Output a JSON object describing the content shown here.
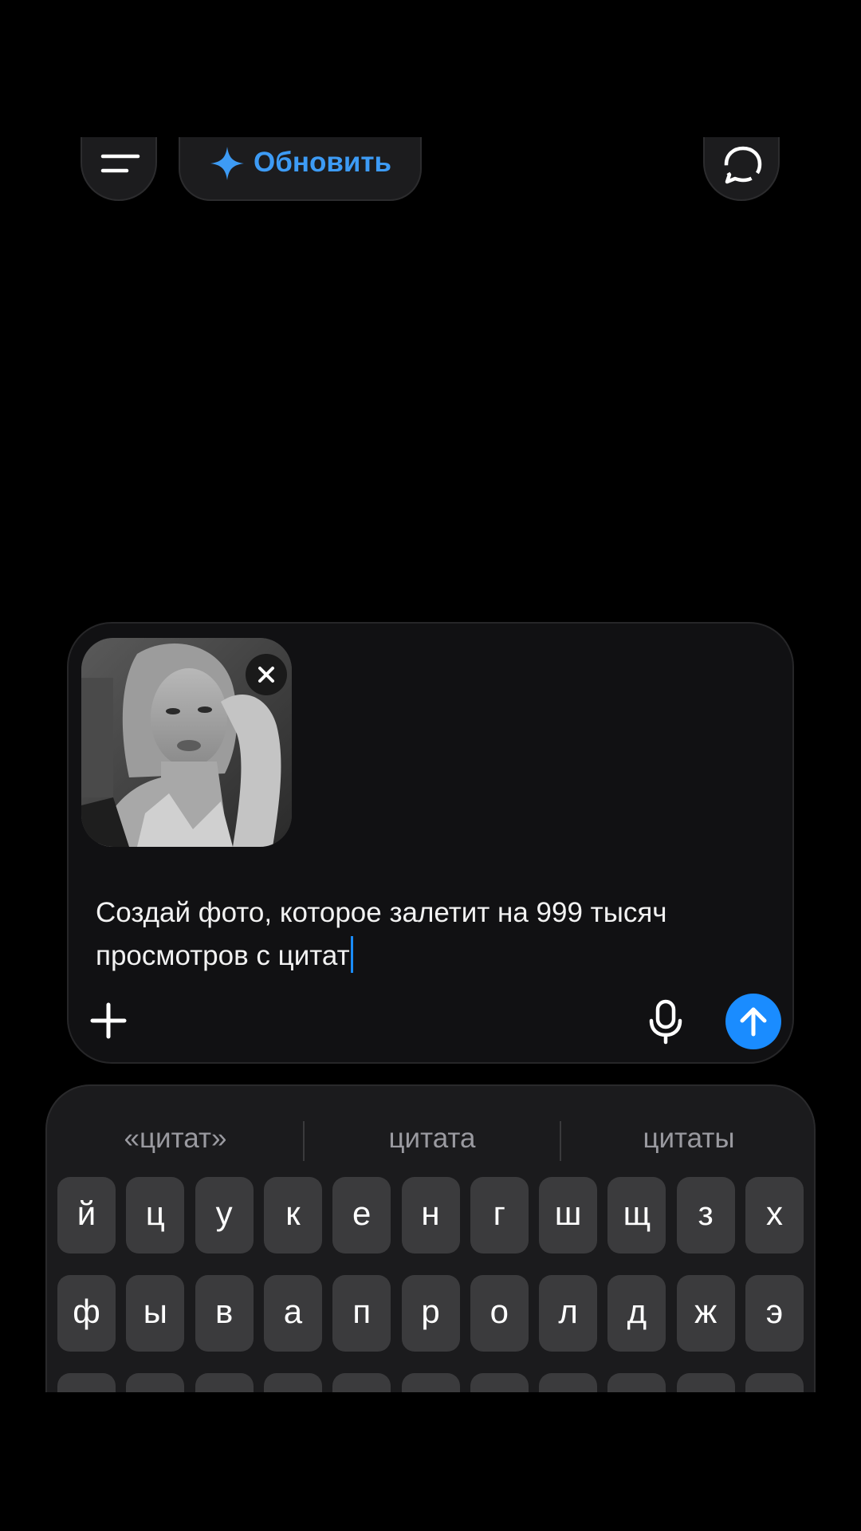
{
  "header": {
    "upgrade_label": "Обновить",
    "accent_color": "#3d9bf5"
  },
  "composer": {
    "prompt_line1": "Создай фото, которое залетит на 999 тысяч",
    "prompt_line2": "просмотров с цитат",
    "send_color": "#1a8cff",
    "attachment": {
      "kind": "photo",
      "tone": "black-and-white portrait"
    }
  },
  "keyboard": {
    "suggestions": [
      "«цитат»",
      "цитата",
      "цитаты"
    ],
    "rows": [
      [
        "й",
        "ц",
        "у",
        "к",
        "е",
        "н",
        "г",
        "ш",
        "щ",
        "з",
        "х"
      ],
      [
        "ф",
        "ы",
        "в",
        "а",
        "п",
        "р",
        "о",
        "л",
        "д",
        "ж",
        "э"
      ]
    ]
  },
  "icons": {
    "menu": "menu-icon",
    "upgrade": "sparkle-icon",
    "new_chat": "chat-bubble-icon",
    "remove": "close-icon",
    "add": "plus-icon",
    "voice": "microphone-icon",
    "send": "arrow-up-icon"
  }
}
